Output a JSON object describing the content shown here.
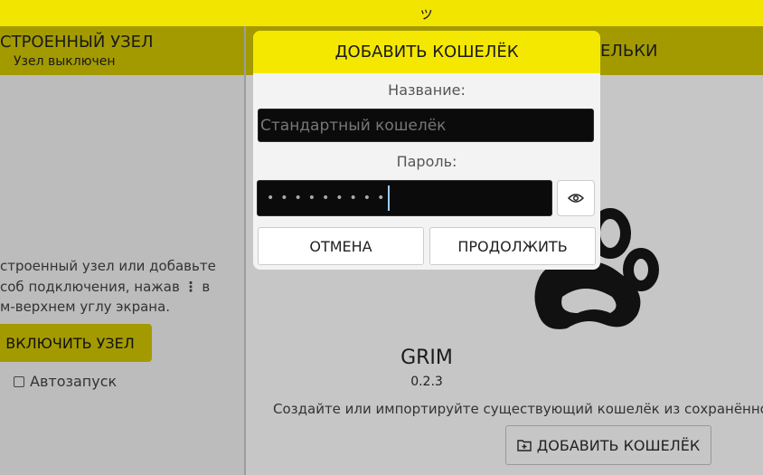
{
  "topbar": {
    "glyph": "ッ"
  },
  "node_header": {
    "title": "СТРОЕННЫЙ УЗЕЛ",
    "status": "Узел выключен"
  },
  "wallets_header": {
    "title": "ЕЛЬКИ"
  },
  "node_panel": {
    "description_lines": [
      "строенный узел или добавьте",
      "соб подключения, нажав",
      "м-верхнем углу экрана."
    ],
    "menu_glyph": "⋮",
    "menu_suffix": "в",
    "enable_button": "ВКЛЮЧИТЬ УЗЕЛ",
    "autostart_label": "Автозапуск"
  },
  "app": {
    "name": "GRIM",
    "version": "0.2.3",
    "description": "Создайте или импортируйте существующий кошелёк из сохранённой",
    "add_wallet_button": "ДОБАВИТЬ КОШЕЛЁК"
  },
  "dialog": {
    "title": "ДОБАВИТЬ КОШЕЛЁК",
    "name_label": "Название:",
    "name_placeholder": "Стандартный кошелёк",
    "password_label": "Пароль:",
    "password_mask": "•••••••••",
    "cancel_button": "ОТМЕНА",
    "continue_button": "ПРОДОЛЖИТЬ"
  },
  "colors": {
    "accent_yellow": "#f2e500",
    "header_olive": "#a39a00",
    "input_dark": "#0b0b0b"
  }
}
